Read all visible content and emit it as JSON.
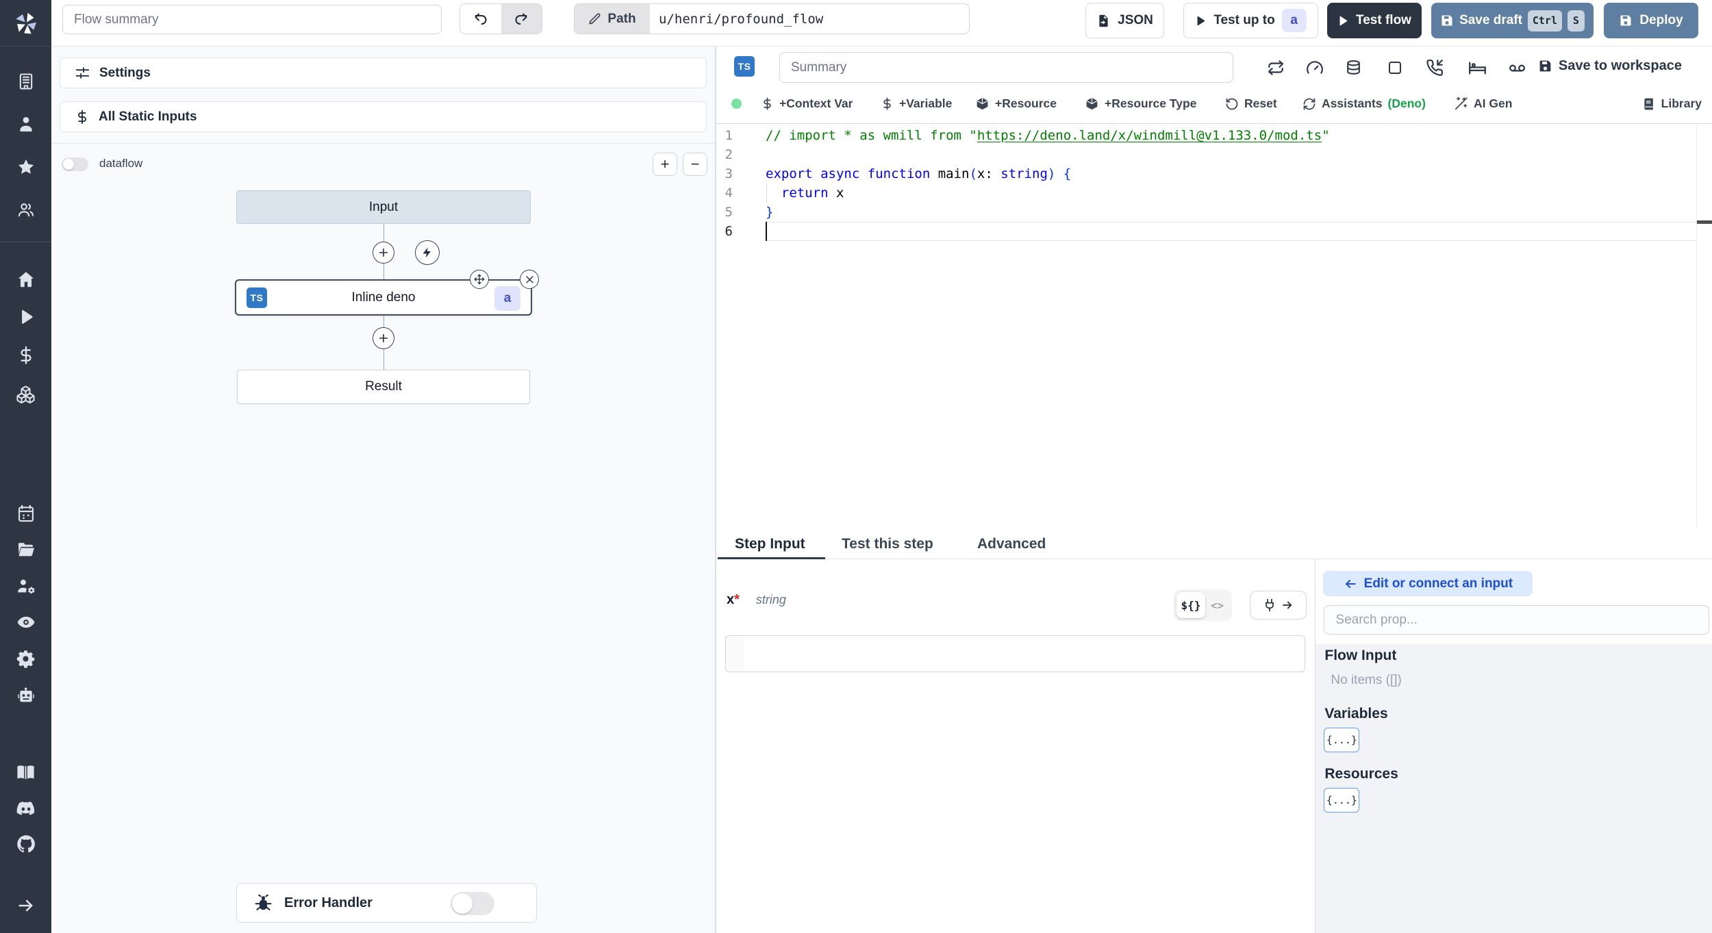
{
  "colors": {
    "sidebar_bg": "#2e3644",
    "dark_button_bg": "#2b3542",
    "slate_button_bg": "#5f7fa2",
    "accent_blue": "#3178c6",
    "link_blue": "#1d4ed8",
    "keyword_blue": "#0000ff",
    "comment_green": "#008000",
    "deno_green": "#16a34a"
  },
  "sidebar": {
    "icons": [
      "windmill-logo",
      "building",
      "user",
      "star",
      "group",
      "home",
      "play",
      "dollar",
      "boxes",
      "calendar",
      "folder-open",
      "users-gear",
      "eye",
      "gear",
      "robot",
      "book-open",
      "discord",
      "github",
      "arrow-right"
    ]
  },
  "topbar": {
    "flow_summary_placeholder": "Flow summary",
    "path_label": "Path",
    "path_value": "u/henri/profound_flow",
    "json_button": "JSON",
    "test_up_to": "Test up to",
    "test_up_to_badge": "a",
    "test_flow": "Test flow",
    "save_draft": "Save draft",
    "kbd_ctrl": "Ctrl",
    "kbd_s": "S",
    "deploy": "Deploy"
  },
  "flow_panel": {
    "settings": "Settings",
    "all_static_inputs": "All Static Inputs",
    "dataflow_label": "dataflow",
    "zoom_in": "+",
    "zoom_out": "−",
    "nodes": {
      "input": "Input",
      "step_title": "Inline deno",
      "step_lang": "TS",
      "step_badge": "a",
      "result": "Result"
    },
    "error_handler": "Error Handler"
  },
  "editor": {
    "lang_badge": "TS",
    "summary_placeholder": "Summary",
    "save_to_workspace": "Save to workspace",
    "toolbar": {
      "context_var": "+Context Var",
      "variable": "+Variable",
      "resource": "+Resource",
      "resource_type": "+Resource Type",
      "reset": "Reset",
      "assistants": "Assistants",
      "assistants_lang": "(Deno)",
      "ai_gen": "AI Gen",
      "library": "Library"
    },
    "code": {
      "lines": [
        [
          {
            "t": "// import * as wmill from \"",
            "c": "tok-comment"
          },
          {
            "t": "https://deno.land/x/windmill@v1.133.0/mod.ts",
            "c": "tok-link"
          },
          {
            "t": "\"",
            "c": "tok-comment"
          }
        ],
        [],
        [
          {
            "t": "export",
            "c": "tok-kw"
          },
          {
            "t": " ",
            "c": ""
          },
          {
            "t": "async",
            "c": "tok-kw"
          },
          {
            "t": " ",
            "c": ""
          },
          {
            "t": "function",
            "c": "tok-kw"
          },
          {
            "t": " main",
            "c": ""
          },
          {
            "t": "(",
            "c": "tok-br"
          },
          {
            "t": "x: ",
            "c": ""
          },
          {
            "t": "string",
            "c": "tok-kw"
          },
          {
            "t": ")",
            "c": "tok-br"
          },
          {
            "t": " ",
            "c": ""
          },
          {
            "t": "{",
            "c": "tok-br"
          }
        ],
        [
          {
            "t": "  ",
            "c": ""
          },
          {
            "t": "return",
            "c": "tok-kw"
          },
          {
            "t": " x",
            "c": ""
          }
        ],
        [
          {
            "t": "}",
            "c": "tok-br"
          }
        ],
        []
      ],
      "active_line": 6
    }
  },
  "step_panel": {
    "tabs": {
      "step_input": "Step Input",
      "test_this_step": "Test this step",
      "advanced": "Advanced"
    },
    "field": {
      "name": "x",
      "required_mark": "*",
      "type": "string"
    },
    "expr_toggle": "${}",
    "code_toggle": "<>"
  },
  "connect_panel": {
    "edit_button": "Edit or connect an input",
    "search_placeholder": "Search prop...",
    "flow_input_title": "Flow Input",
    "flow_input_empty": "No items ([])",
    "variables_title": "Variables",
    "variables_chip": "{...}",
    "resources_title": "Resources",
    "resources_chip": "{...}"
  }
}
